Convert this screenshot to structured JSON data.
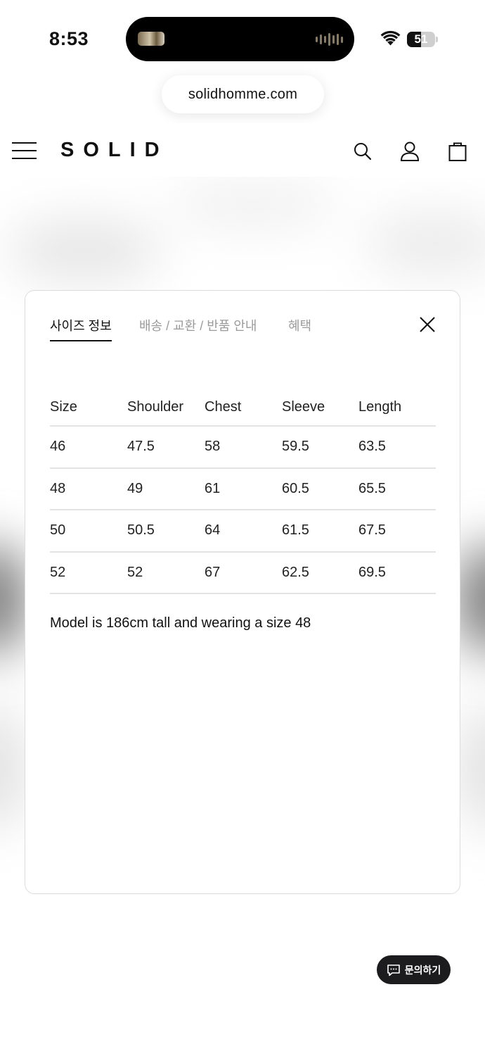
{
  "status_bar": {
    "time": "8:53",
    "battery_level": "51",
    "battery_fraction": 0.51
  },
  "browser": {
    "url": "solidhomme.com"
  },
  "header": {
    "logo": "SOLID",
    "icons": [
      "menu-icon",
      "search-icon",
      "account-icon",
      "shopping-bag-icon"
    ]
  },
  "modal": {
    "tabs": [
      {
        "label": "사이즈 정보",
        "active": true
      },
      {
        "label": "배송 / 교환 / 반품 안내",
        "active": false
      },
      {
        "label": "혜택",
        "active": false
      }
    ],
    "table": {
      "headers": [
        "Size",
        "Shoulder",
        "Chest",
        "Sleeve",
        "Length"
      ],
      "rows": [
        [
          "46",
          "47.5",
          "58",
          "59.5",
          "63.5"
        ],
        [
          "48",
          "49",
          "61",
          "60.5",
          "65.5"
        ],
        [
          "50",
          "50.5",
          "64",
          "61.5",
          "67.5"
        ],
        [
          "52",
          "52",
          "67",
          "62.5",
          "69.5"
        ]
      ]
    },
    "note": "Model is 186cm tall and wearing a size 48"
  },
  "inquiry_button": {
    "label": "문의하기"
  },
  "colors": {
    "text": "#111111",
    "muted_tab": "#9a9a9a",
    "divider": "#e3e3e3",
    "button_bg": "#1c1c1e"
  }
}
